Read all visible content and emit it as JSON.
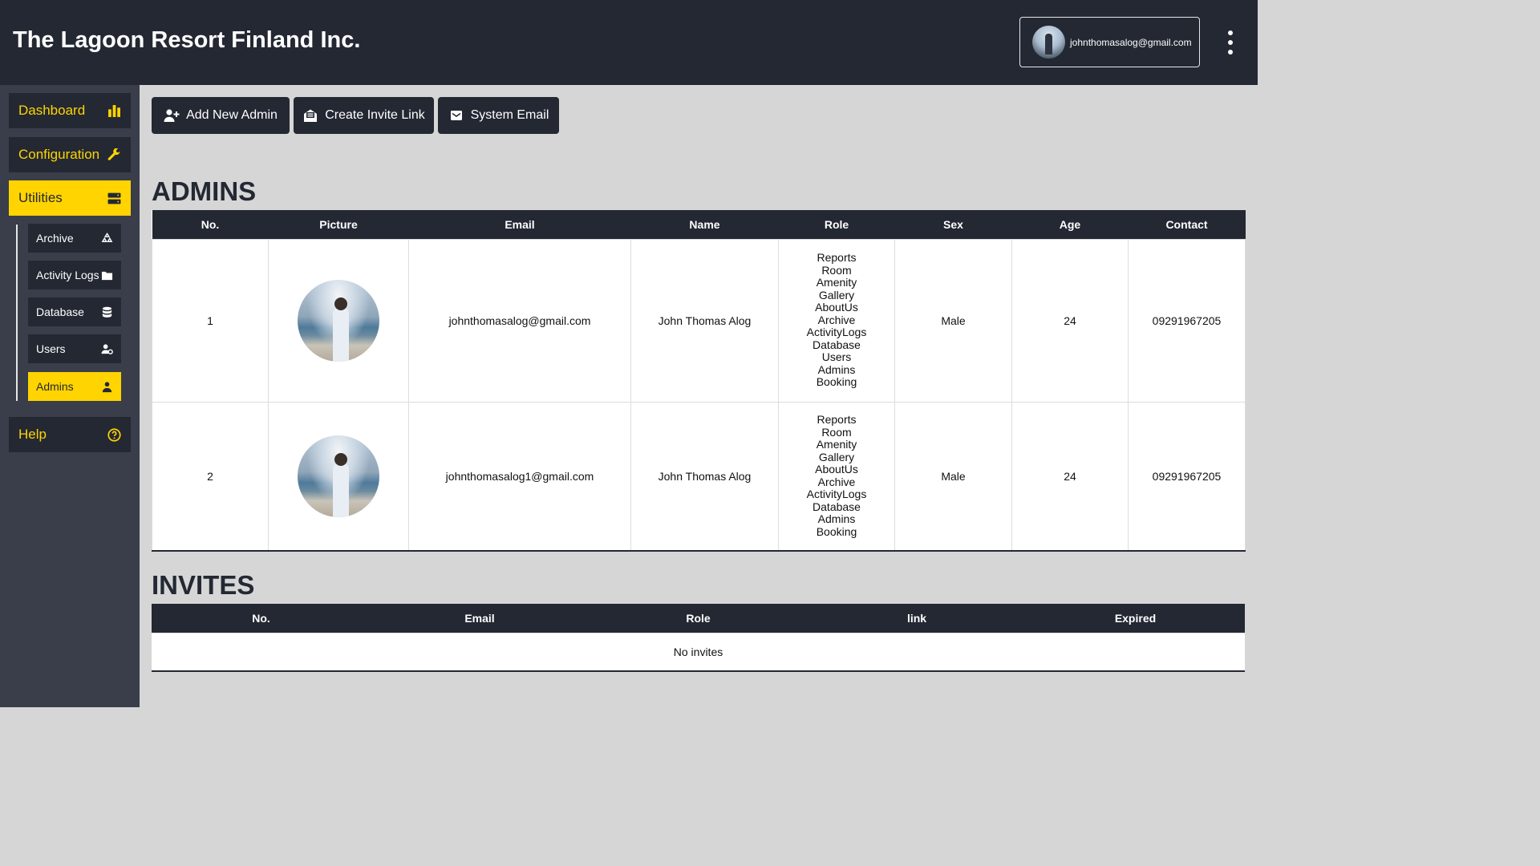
{
  "header": {
    "brand": "The Lagoon Resort Finland Inc.",
    "user_email": "johnthomasalog@gmail.com"
  },
  "sidebar": {
    "items": [
      {
        "label": "Dashboard",
        "icon": "bar-chart-icon"
      },
      {
        "label": "Configuration",
        "icon": "wrench-icon"
      },
      {
        "label": "Utilities",
        "icon": "server-icon"
      },
      {
        "label": "Help",
        "icon": "question-circle-icon"
      }
    ],
    "sub_items": [
      {
        "label": "Archive",
        "icon": "recycle-icon"
      },
      {
        "label": "Activity Logs",
        "icon": "folder-icon"
      },
      {
        "label": "Database",
        "icon": "database-icon"
      },
      {
        "label": "Users",
        "icon": "users-cog-icon"
      },
      {
        "label": "Admins",
        "icon": "admin-user-icon"
      }
    ],
    "accent": "#ffd400",
    "dark": "#232833"
  },
  "toolbar": {
    "add_admin": "Add New Admin",
    "invite_link": "Create Invite Link",
    "system_email": "System Email"
  },
  "admins": {
    "title": "ADMINS",
    "columns": [
      "No.",
      "Picture",
      "Email",
      "Name",
      "Role",
      "Sex",
      "Age",
      "Contact"
    ],
    "rows": [
      {
        "no": "1",
        "email": "johnthomasalog@gmail.com",
        "name": "John Thomas Alog",
        "roles": [
          "Reports",
          "Room",
          "Amenity",
          "Gallery",
          "AboutUs",
          "Archive",
          "ActivityLogs",
          "Database",
          "Users",
          "Admins",
          "Booking"
        ],
        "sex": "Male",
        "age": "24",
        "contact": "09291967205"
      },
      {
        "no": "2",
        "email": "johnthomasalog1@gmail.com",
        "name": "John Thomas Alog",
        "roles": [
          "Reports",
          "Room",
          "Amenity",
          "Gallery",
          "AboutUs",
          "Archive",
          "ActivityLogs",
          "Database",
          "Admins",
          "Booking"
        ],
        "sex": "Male",
        "age": "24",
        "contact": "09291967205"
      }
    ]
  },
  "invites": {
    "title": "INVITES",
    "columns": [
      "No.",
      "Email",
      "Role",
      "link",
      "Expired"
    ],
    "empty_text": "No invites"
  }
}
